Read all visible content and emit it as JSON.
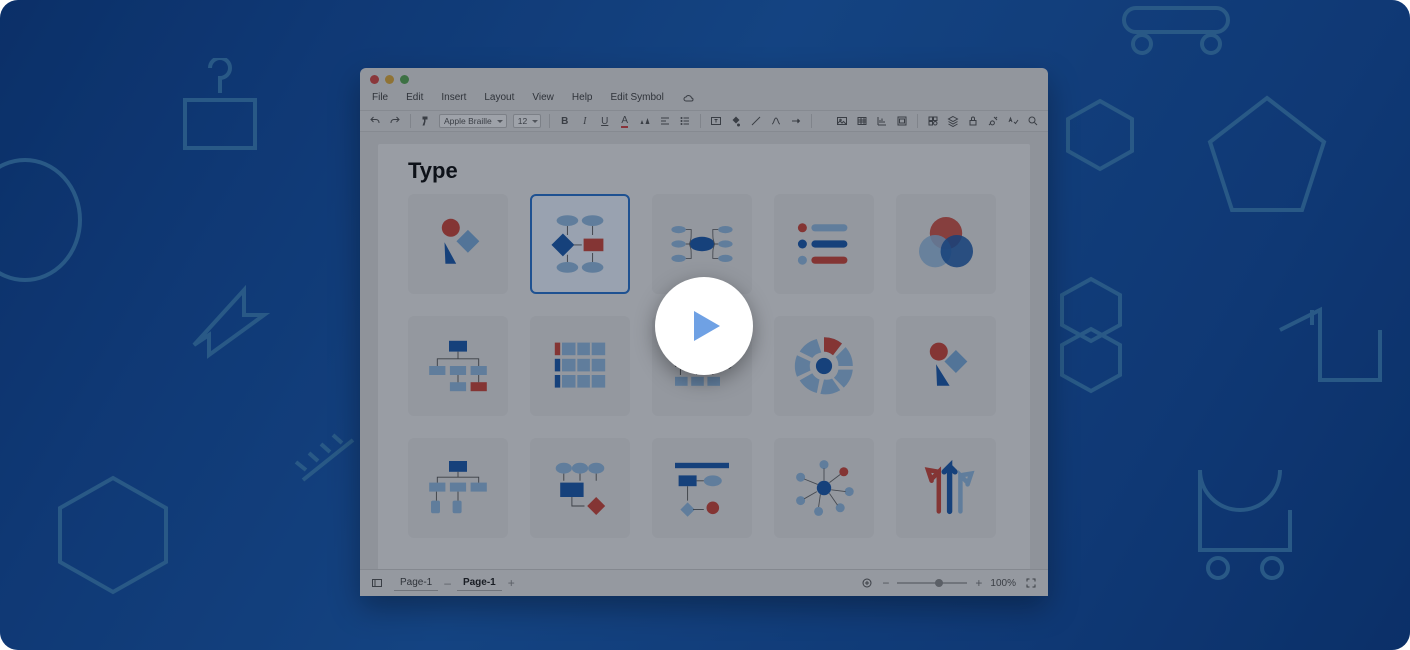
{
  "menubar": {
    "file": "File",
    "edit": "Edit",
    "insert": "Insert",
    "layout": "Layout",
    "view": "View",
    "help": "Help",
    "edit_symbol": "Edit Symbol"
  },
  "toolbar": {
    "font": "Apple Braille",
    "size": "12"
  },
  "doc": {
    "title": "Type"
  },
  "status": {
    "tab1": "Page-1",
    "tab2": "Page-1",
    "zoom": "100%"
  },
  "templates": [
    "basic-shapes",
    "flowchart",
    "mindmap",
    "list",
    "venn",
    "org-chart",
    "matrix",
    "timeline",
    "radial",
    "basic-shapes-alt",
    "tree",
    "process",
    "swimlane",
    "network",
    "arrows"
  ]
}
